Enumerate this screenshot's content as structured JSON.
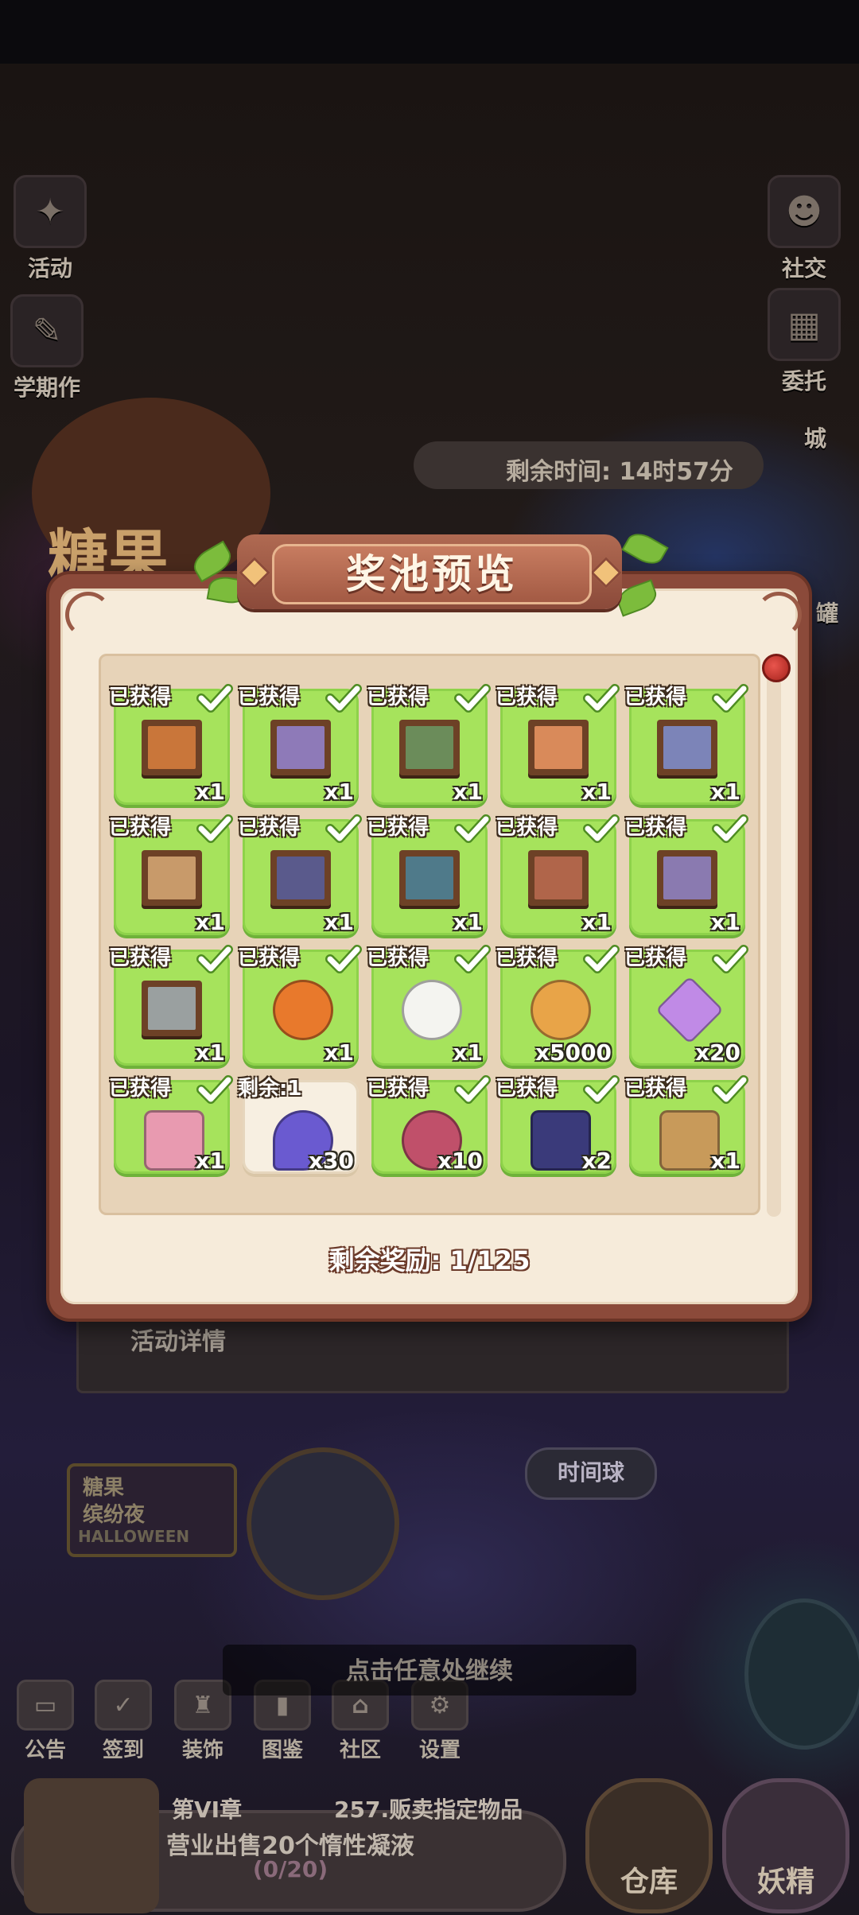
{
  "background": {
    "hud": {
      "left_buttons": [
        {
          "label": "活动",
          "icon": "activity-icon"
        },
        {
          "label": "学期作",
          "icon": "notebook-icon"
        }
      ],
      "right_buttons": [
        {
          "label": "社交",
          "icon": "social-icon"
        },
        {
          "label": "委托",
          "icon": "commission-icon"
        },
        {
          "label": "城",
          "icon": "town-icon"
        },
        {
          "label": "罐",
          "icon": "jar-icon"
        }
      ],
      "event_timer": "剩余时间: 14时57分",
      "event_logo_text": "糖果",
      "event_details_label": "活动详情",
      "poster_line1": "糖果",
      "poster_line2": "缤纷夜",
      "poster_line3": "HALLOWEEN",
      "time_ball_label": "时间球",
      "bottom_tabs": [
        {
          "label": "公告",
          "icon": "announcement-icon"
        },
        {
          "label": "签到",
          "icon": "calendar-check-icon"
        },
        {
          "label": "装饰",
          "icon": "decoration-icon"
        },
        {
          "label": "图鉴",
          "icon": "collection-book-icon"
        },
        {
          "label": "社区",
          "icon": "community-icon"
        },
        {
          "label": "设置",
          "icon": "settings-gear-icon"
        }
      ],
      "quest": {
        "chapter": "第VI章",
        "name": "257.贩卖指定物品",
        "description": "营业出售20个惰性凝液",
        "progress": "(0/20)"
      },
      "warehouse_label": "仓库",
      "fairy_label": "妖精"
    }
  },
  "modal": {
    "title": "奖池预览",
    "remaining_rewards": "剩余奖励: 1/125",
    "rewards": [
      {
        "status": "已获得",
        "owned": true,
        "qty": "x1",
        "icon": "framed-painting-pumpkin-icon",
        "color": "#c9763a"
      },
      {
        "status": "已获得",
        "owned": true,
        "qty": "x1",
        "icon": "framed-painting-balloons-icon",
        "color": "#8e7ab8"
      },
      {
        "status": "已获得",
        "owned": true,
        "qty": "x1",
        "icon": "framed-painting-party-icon",
        "color": "#6b8c5a"
      },
      {
        "status": "已获得",
        "owned": true,
        "qty": "x1",
        "icon": "framed-painting-feast-icon",
        "color": "#d98a5a"
      },
      {
        "status": "已获得",
        "owned": true,
        "qty": "x1",
        "icon": "framed-painting-castle-icon",
        "color": "#7c84b8"
      },
      {
        "status": "已获得",
        "owned": true,
        "qty": "x1",
        "icon": "framed-painting-candy-icon",
        "color": "#c89a6a"
      },
      {
        "status": "已获得",
        "owned": true,
        "qty": "x1",
        "icon": "framed-painting-night-icon",
        "color": "#5a5a8c"
      },
      {
        "status": "已获得",
        "owned": true,
        "qty": "x1",
        "icon": "framed-painting-witch-icon",
        "color": "#4f7a8a"
      },
      {
        "status": "已获得",
        "owned": true,
        "qty": "x1",
        "icon": "framed-painting-garden-icon",
        "color": "#b0654a"
      },
      {
        "status": "已获得",
        "owned": true,
        "qty": "x1",
        "icon": "framed-painting-ghost-icon",
        "color": "#8a7ab0"
      },
      {
        "status": "已获得",
        "owned": true,
        "qty": "x1",
        "icon": "framed-painting-flowers-icon",
        "color": "#9aa0a0"
      },
      {
        "status": "已获得",
        "owned": true,
        "qty": "x1",
        "icon": "pumpkin-witch-hat-icon",
        "color": "#e8792c"
      },
      {
        "status": "已获得",
        "owned": true,
        "qty": "x1",
        "icon": "ghost-icon",
        "color": "#f4f4f0"
      },
      {
        "status": "已获得",
        "owned": true,
        "qty": "x5000",
        "icon": "gold-coin-icon",
        "color": "#e8a448"
      },
      {
        "status": "已获得",
        "owned": true,
        "qty": "x20",
        "icon": "purple-gem-icon",
        "color": "#c08ae6"
      },
      {
        "status": "已获得",
        "owned": true,
        "qty": "x1",
        "icon": "candy-key-icon",
        "color": "#e89ab0"
      },
      {
        "status": "剩余:1",
        "owned": false,
        "qty": "x30",
        "icon": "hourglass-potion-icon",
        "color": "#6a5ad0"
      },
      {
        "status": "已获得",
        "owned": true,
        "qty": "x10",
        "icon": "macaron-icon",
        "color": "#c0506a"
      },
      {
        "status": "已获得",
        "owned": true,
        "qty": "x2",
        "icon": "ticket-icon",
        "color": "#3a3a7a"
      },
      {
        "status": "已获得",
        "owned": true,
        "qty": "x1",
        "icon": "treasure-map-icon",
        "color": "#c89a5a"
      }
    ]
  },
  "continue_hint": "点击任意处继续"
}
